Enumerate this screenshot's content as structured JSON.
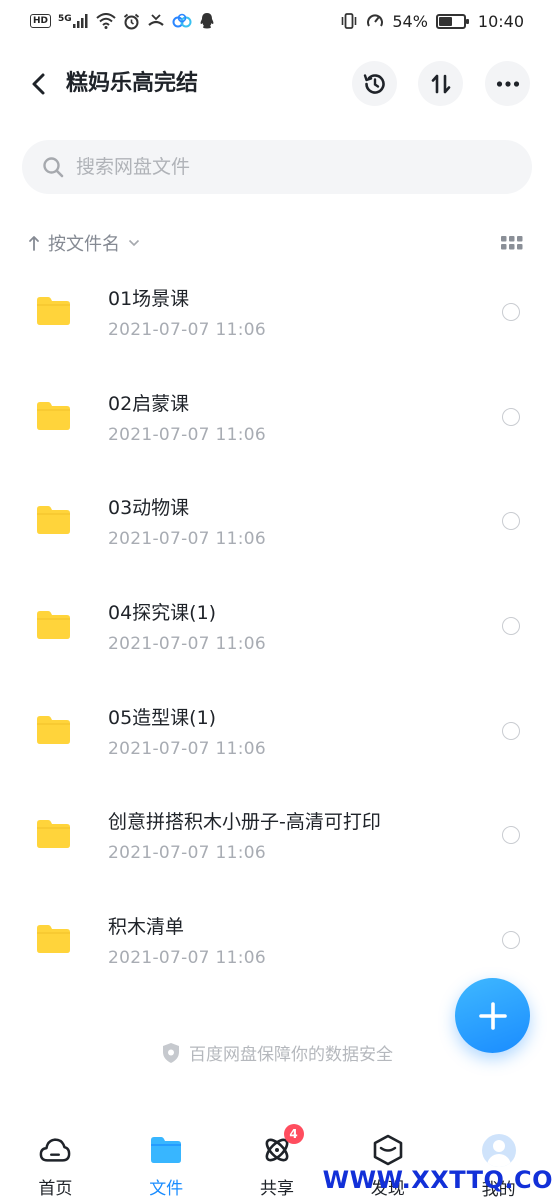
{
  "status_bar": {
    "hd_badge": "HD",
    "signal_label": "5G",
    "battery_text": "54%",
    "battery_level": 54,
    "time": "10:40"
  },
  "header": {
    "title": "糕妈乐高完结",
    "back_icon": "chevron-left-icon",
    "history_icon": "history-icon",
    "sort_icon": "sort-icon",
    "more_icon": "more-icon"
  },
  "search": {
    "placeholder": "搜索网盘文件",
    "value": ""
  },
  "sort": {
    "label": "按文件名",
    "direction_icon": "arrow-up-icon"
  },
  "files": [
    {
      "name": "01场景课",
      "date": "2021-07-07  11:06"
    },
    {
      "name": "02启蒙课",
      "date": "2021-07-07  11:06"
    },
    {
      "name": "03动物课",
      "date": "2021-07-07  11:06"
    },
    {
      "name": "04探究课(1)",
      "date": "2021-07-07  11:06"
    },
    {
      "name": "05造型课(1)",
      "date": "2021-07-07  11:06"
    },
    {
      "name": "创意拼搭积木小册子-高清可打印",
      "date": "2021-07-07  11:06"
    },
    {
      "name": "积木清单",
      "date": "2021-07-07  11:06"
    }
  ],
  "safe_note": "百度网盘保障你的数据安全",
  "fab_icon": "plus-icon",
  "nav": {
    "home": "首页",
    "files": "文件",
    "share": "共享",
    "share_badge": "4",
    "discover": "发现",
    "me": "我的"
  },
  "watermark": "WWW.XXTTQ.COM",
  "colors": {
    "accent": "#1a8cff",
    "folder": "#ffd43b",
    "badge": "#ff4d5e",
    "watermark": "#1230d8"
  }
}
